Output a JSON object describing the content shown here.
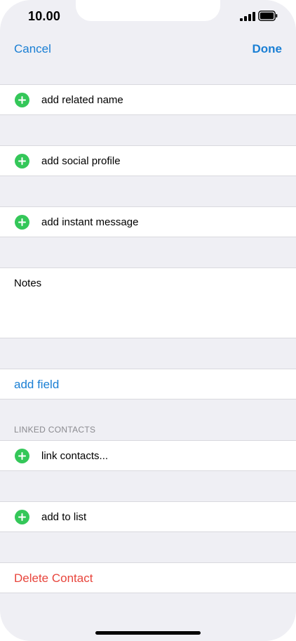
{
  "status_bar": {
    "time": "10.00"
  },
  "nav": {
    "cancel_label": "Cancel",
    "done_label": "Done"
  },
  "rows": {
    "related_name": "add related name",
    "social_profile": "add social profile",
    "instant_message": "add instant message",
    "notes": "Notes",
    "add_field": "add field",
    "linked_contacts_header": "LINKED CONTACTS",
    "link_contacts": "link contacts...",
    "add_to_list": "add to list",
    "delete_contact": "Delete Contact"
  },
  "icons": {
    "add": "plus-circle-icon",
    "signal": "cellular-signal-icon",
    "battery": "battery-icon"
  },
  "colors": {
    "accent": "#1a7fd4",
    "destructive": "#e8453c",
    "add_icon": "#34c759",
    "grouped_background": "#efeff4"
  }
}
